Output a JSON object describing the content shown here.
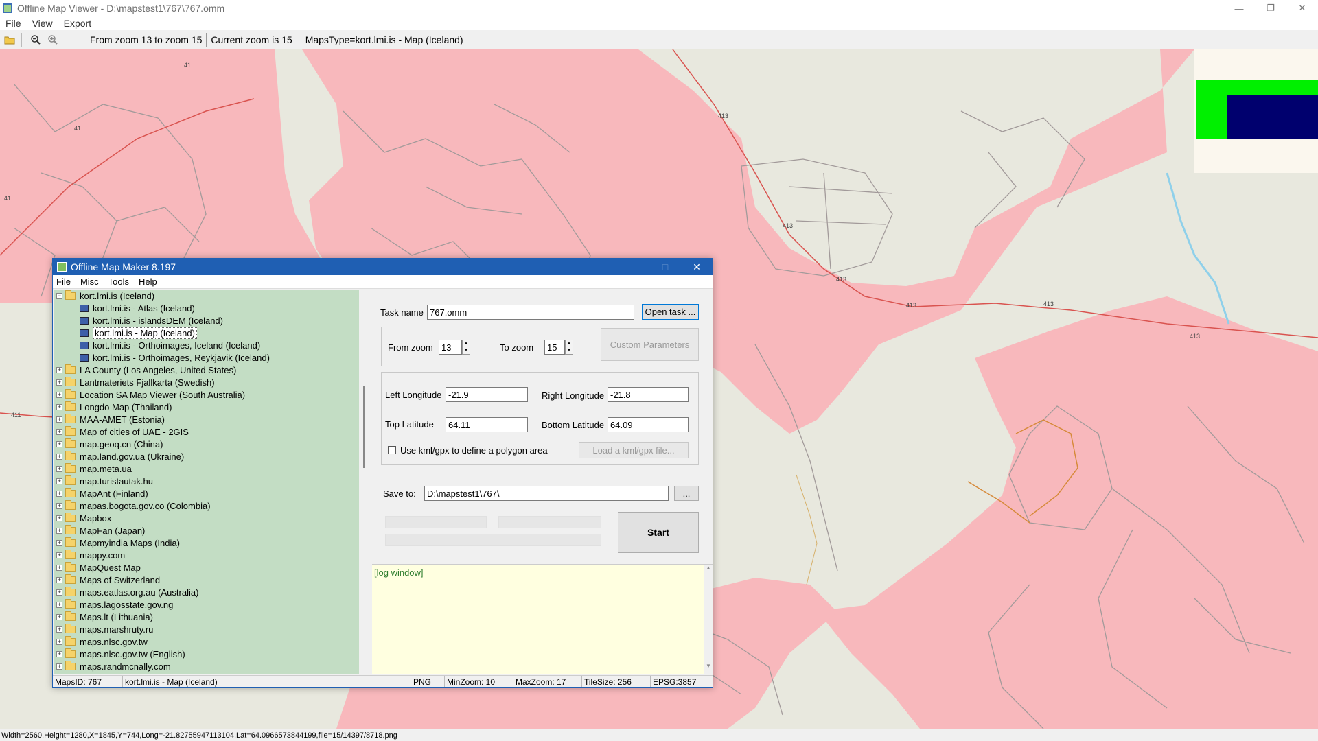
{
  "window": {
    "title": "Offline Map Viewer - D:\\mapstest1\\767\\767.omm",
    "menu": [
      "File",
      "View",
      "Export"
    ]
  },
  "toolbar": {
    "zoom_range": "From zoom 13 to zoom 15",
    "current_zoom": "Current zoom is 15",
    "maps_type": "MapsType=kort.lmi.is - Map (Iceland)"
  },
  "map": {
    "road_labels": [
      "41",
      "41",
      "41",
      "413",
      "413",
      "413",
      "413",
      "413",
      "413",
      "411"
    ]
  },
  "status": {
    "text": "Width=2560,Height=1280,X=1845,Y=744,Long=-21.82755947113104,Lat=64.0966573844199,file=15/14397/8718.png"
  },
  "dialog": {
    "title": "Offline Map Maker 8.197",
    "menu": [
      "File",
      "Misc",
      "Tools",
      "Help"
    ],
    "tree": {
      "root": "kort.lmi.is (Iceland)",
      "children": [
        "kort.lmi.is - Atlas (Iceland)",
        "kort.lmi.is - islandsDEM (Iceland)",
        "kort.lmi.is - Map (Iceland)",
        "kort.lmi.is - Orthoimages, Iceland (Iceland)",
        "kort.lmi.is - Orthoimages, Reykjavik (Iceland)"
      ],
      "folders": [
        "LA County (Los Angeles, United States)",
        "Lantmateriets Fjallkarta (Swedish)",
        "Location SA Map Viewer (South Australia)",
        "Longdo Map (Thailand)",
        "MAA-AMET (Estonia)",
        "Map of cities of UAE - 2GIS",
        "map.geoq.cn (China)",
        "map.land.gov.ua (Ukraine)",
        "map.meta.ua",
        "map.turistautak.hu",
        "MapAnt (Finland)",
        "mapas.bogota.gov.co (Colombia)",
        "Mapbox",
        "MapFan (Japan)",
        "Mapmyindia Maps (India)",
        "mappy.com",
        "MapQuest Map",
        "Maps of Switzerland",
        "maps.eatlas.org.au (Australia)",
        "maps.lagosstate.gov.ng",
        "Maps.lt (Lithuania)",
        "maps.marshruty.ru",
        "maps.nlsc.gov.tw",
        "maps.nlsc.gov.tw (English)",
        "maps.randmcnally.com"
      ]
    },
    "form": {
      "task_name_label": "Task name",
      "task_name_value": "767.omm",
      "open_task": "Open task ...",
      "from_zoom_label": "From zoom",
      "from_zoom_value": "13",
      "to_zoom_label": "To zoom",
      "to_zoom_value": "15",
      "custom_params": "Custom Parameters",
      "left_lon_label": "Left Longitude",
      "left_lon_value": "-21.9",
      "right_lon_label": "Right Longitude",
      "right_lon_value": "-21.8",
      "top_lat_label": "Top Latitude",
      "top_lat_value": "64.11",
      "bottom_lat_label": "Bottom Latitude",
      "bottom_lat_value": "64.09",
      "kml_check_label": "Use kml/gpx to define a polygon area",
      "load_kml": "Load a kml/gpx file...",
      "save_to_label": "Save to:",
      "save_to_value": "D:\\mapstest1\\767\\",
      "browse": "...",
      "start": "Start"
    },
    "log": "[log window]",
    "statusbar": {
      "maps_id": "MapsID: 767",
      "map_name": "kort.lmi.is - Map (Iceland)",
      "format": "PNG",
      "min_zoom": "MinZoom: 10",
      "max_zoom": "MaxZoom: 17",
      "tile_size": "TileSize: 256",
      "epsg": "EPSG:3857"
    }
  },
  "colors": {
    "urban": "#f8b8bc",
    "land": "#e8e8de",
    "road": "#9a9a9a",
    "main_road": "#d9534f",
    "tree_bg": "#c3ddc4",
    "dialog_title": "#1f5fb3",
    "log_bg": "#ffffe0"
  }
}
